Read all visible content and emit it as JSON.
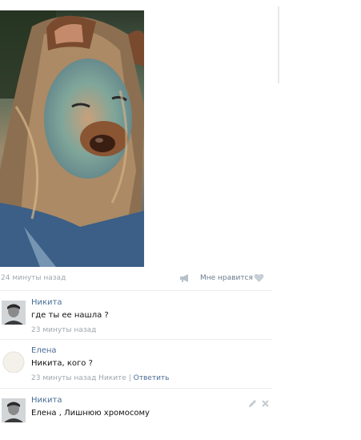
{
  "post": {
    "time": "24 минуты назад",
    "like_label": "Мне нравится"
  },
  "comments": [
    {
      "author": "Никита",
      "text": "где ты ее нашла ?",
      "time": "23 минуты назад"
    },
    {
      "author": "Елена",
      "text": "Никита, кого ?",
      "time": "23 минуты назад",
      "reply_to": "Никите",
      "divider": "|",
      "reply_label": "Ответить"
    },
    {
      "author": "Никита",
      "text": "Елена , Лишнюю хромосому"
    }
  ],
  "colors": {
    "link": "#4a6d95",
    "meta": "#a0a6ad",
    "separator": "#e9ecef"
  },
  "icons": {
    "share": "megaphone-icon",
    "like": "heart-icon",
    "edit": "pencil-icon",
    "delete": "close-icon"
  }
}
